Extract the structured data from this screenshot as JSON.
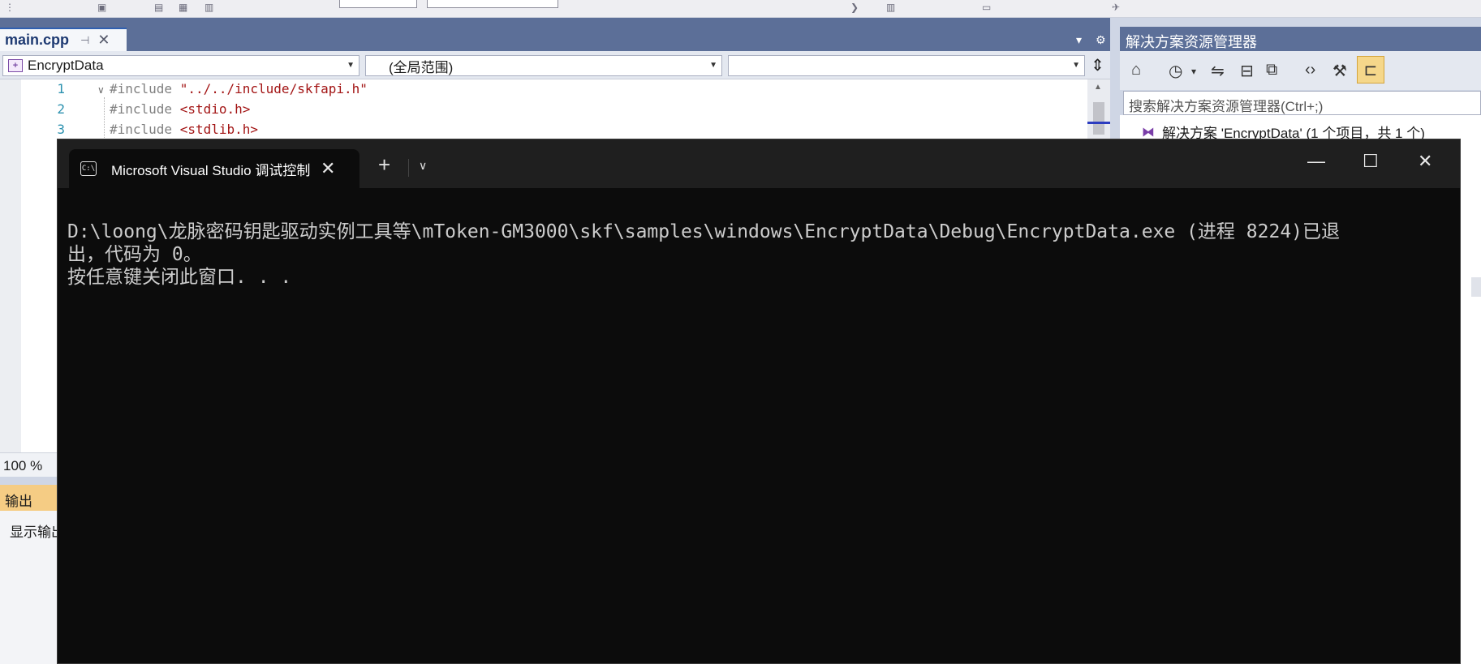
{
  "editor": {
    "tab_label": "main.cpp",
    "pin_icon": "pin-icon",
    "close_icon": "close-icon",
    "nav": {
      "project": "EncryptData",
      "scope": "(全局范围)",
      "member": ""
    },
    "code_lines": [
      {
        "num": "1",
        "pp": "#include ",
        "str": "\"../../include/skfapi.h\""
      },
      {
        "num": "2",
        "pp": "#include ",
        "str": "<stdio.h>"
      },
      {
        "num": "3",
        "pp": "#include ",
        "str": "<stdlib.h>"
      }
    ],
    "zoom": "100 %"
  },
  "output": {
    "title": "输出",
    "show_label": "显示输出"
  },
  "solution_explorer": {
    "title": "解决方案资源管理器",
    "search_placeholder": "搜索解决方案资源管理器(Ctrl+;)",
    "root_label": "解决方案 'EncryptData' (1 个项目，共 1 个)"
  },
  "console": {
    "tab_title": "Microsoft Visual Studio 调试控制台",
    "lines": [
      "D:\\loong\\龙脉密码钥匙驱动实例工具等\\mToken-GM3000\\skf\\samples\\windows\\EncryptData\\Debug\\EncryptData.exe (进程 8224)已退",
      "出，代码为 0。",
      "按任意键关闭此窗口. . ."
    ]
  },
  "colors": {
    "vs_frame": "#5c6f98",
    "console_bg": "#0c0c0c",
    "output_header": "#f5cc84"
  }
}
